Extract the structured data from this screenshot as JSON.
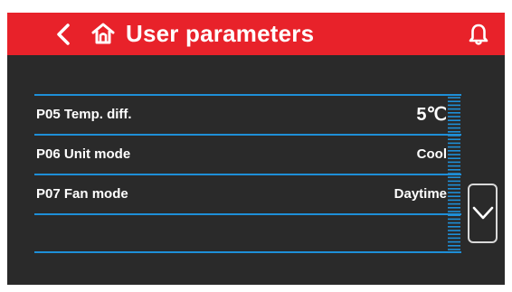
{
  "header": {
    "title": "User parameters",
    "back_icon": "chevron-left-icon",
    "home_icon": "home-icon",
    "alarm_icon": "bell-icon",
    "background_color": "#e8222a"
  },
  "parameters": [
    {
      "label": "P05 Temp. diff.",
      "value": "5℃"
    },
    {
      "label": "P06 Unit mode",
      "value": "Cool"
    },
    {
      "label": "P07 Fan mode",
      "value": "Daytime"
    }
  ],
  "navigation": {
    "scroll_down_icon": "chevron-down-icon"
  },
  "colors": {
    "accent": "#1e8fd8",
    "screen_background": "#2a2a2a",
    "text": "#ffffff"
  }
}
